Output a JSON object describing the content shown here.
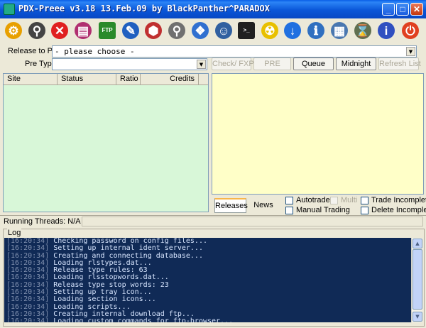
{
  "window": {
    "title": "PDX-Preee v3.18 13.Feb.09 by BlackPanther^PARADOX",
    "controls": {
      "minimize": "_",
      "maximize": "□",
      "close": "✕"
    }
  },
  "toolbar": {
    "items": [
      {
        "name": "settings-gears-icon",
        "glyph": "⚙",
        "color": "#e8a000"
      },
      {
        "name": "connect-plug-icon",
        "glyph": "⚲",
        "color": "#444444"
      },
      {
        "name": "stop-icon",
        "glyph": "✕",
        "color": "#e02020"
      },
      {
        "name": "archive-books-icon",
        "glyph": "▤",
        "color": "#b03070"
      },
      {
        "name": "ftp-icon",
        "glyph": "FTP",
        "color": "#2a8a2a"
      },
      {
        "name": "edit-notes-icon",
        "glyph": "✎",
        "color": "#2060c0"
      },
      {
        "name": "clear-bucket-icon",
        "glyph": "⬢",
        "color": "#c03030"
      },
      {
        "name": "search-icon",
        "glyph": "⚲",
        "color": "#707070"
      },
      {
        "name": "network-icon",
        "glyph": "❖",
        "color": "#3070d0"
      },
      {
        "name": "users-icon",
        "glyph": "☺",
        "color": "#3060a0"
      },
      {
        "name": "terminal-icon",
        "glyph": ">_",
        "color": "#202020"
      },
      {
        "name": "nuke-icon",
        "glyph": "☢",
        "color": "#e8c000"
      },
      {
        "name": "download-arrow-icon",
        "glyph": "↓",
        "color": "#2070e0"
      },
      {
        "name": "info-document-icon",
        "glyph": "ℹ",
        "color": "#3070c0"
      },
      {
        "name": "statistics-window-icon",
        "glyph": "▦",
        "color": "#4a78b0"
      },
      {
        "name": "scheduler-icon",
        "glyph": "⌛",
        "color": "#607050"
      },
      {
        "name": "help-icon",
        "glyph": "i",
        "color": "#3050c0"
      },
      {
        "name": "power-exit-icon",
        "glyph": "⏻",
        "color": "#e04020"
      }
    ]
  },
  "form": {
    "release_label": "Release to Pre",
    "release_value": "- please choose -",
    "pretype_label": "Pre Type",
    "pretype_value": ""
  },
  "buttons": {
    "check_fxp": "Check/ FXP",
    "pre": "PRE",
    "queue": "Queue",
    "midnight": "Midnight",
    "refresh_list": "Refresh List"
  },
  "site_grid": {
    "columns": [
      "Site",
      "Status",
      "Ratio",
      "Credits"
    ],
    "rows": []
  },
  "panel": {
    "tabs": [
      "Releases",
      "News"
    ],
    "active_tab": "Releases",
    "checkboxes": [
      {
        "label": "Autotrade",
        "checked": false,
        "enabled": true
      },
      {
        "label": "Multi",
        "checked": false,
        "enabled": false
      },
      {
        "label": "Trade Incomplete",
        "checked": false,
        "enabled": true
      },
      {
        "label": "Manual Trading",
        "checked": false,
        "enabled": true
      },
      {
        "label": "Delete Incomplete",
        "checked": false,
        "enabled": true
      }
    ]
  },
  "status": {
    "running_threads": "Running Threads: N/A"
  },
  "log": {
    "title": "Log",
    "lines": [
      {
        "ts": "[16:20:34]",
        "text": "Checking password on config files..."
      },
      {
        "ts": "[16:20:34]",
        "text": "Setting up internal ident server..."
      },
      {
        "ts": "[16:20:34]",
        "text": "Creating and connecting database..."
      },
      {
        "ts": "[16:20:34]",
        "text": "Loading rlstypes.dat..."
      },
      {
        "ts": "[16:20:34]",
        "text": "Release type rules: 63"
      },
      {
        "ts": "[16:20:34]",
        "text": "Loading rlsstopwords.dat..."
      },
      {
        "ts": "[16:20:34]",
        "text": "Release type stop words: 23"
      },
      {
        "ts": "[16:20:34]",
        "text": "Setting up tray icon..."
      },
      {
        "ts": "[16:20:34]",
        "text": "Loading section icons..."
      },
      {
        "ts": "[16:20:34]",
        "text": "Loading scripts..."
      },
      {
        "ts": "[16:20:34]",
        "text": "Creating internal download ftp..."
      },
      {
        "ts": "[16:20:34]",
        "text": "Loading custom commands for ftp-browser..."
      }
    ]
  },
  "colors": {
    "title_bar": "#0a56d8",
    "site_grid_bg": "#d8f7d8",
    "release_panel_bg": "#ffffc8",
    "log_bg": "#102a56"
  }
}
